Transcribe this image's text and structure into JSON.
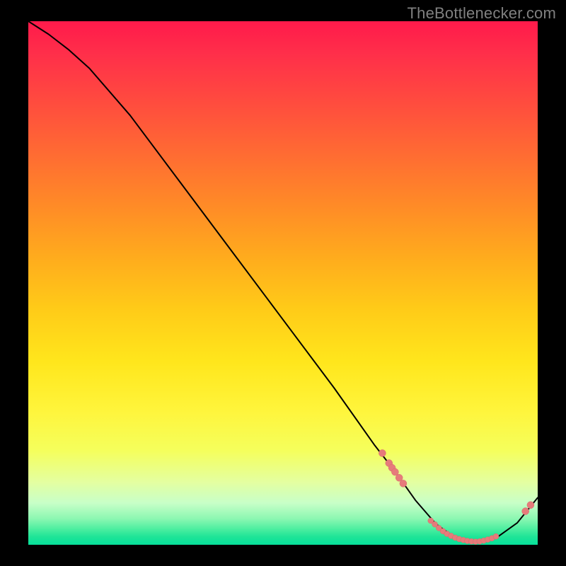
{
  "watermark": "TheBottlenecker.com",
  "colors": {
    "line": "#000000",
    "point_fill": "#e67b7b",
    "point_stroke": "#d86a6a",
    "gradient_top": "#ff1a4b",
    "gradient_bottom": "#07e09a",
    "background": "#000000"
  },
  "chart_data": {
    "type": "line",
    "title": "",
    "xlabel": "",
    "ylabel": "",
    "xlim": [
      0,
      100
    ],
    "ylim": [
      0,
      100
    ],
    "grid": false,
    "legend": false,
    "note": "Axes not labeled in source; x normalized 0–100 left→right, y 0–100 bottom→top. Curve is bottleneck-percentage shape: high at left, descends to ~0 near x≈85, then rises slightly.",
    "series": [
      {
        "name": "curve",
        "x": [
          0,
          4,
          8,
          12,
          20,
          30,
          40,
          50,
          60,
          68,
          72,
          76,
          80,
          84,
          88,
          92,
          96,
          100
        ],
        "y": [
          100,
          97.5,
          94.5,
          91,
          82,
          69,
          56,
          43,
          30,
          19,
          14,
          8.5,
          4,
          1.2,
          0.6,
          1.4,
          4.2,
          9
        ]
      }
    ],
    "points": [
      {
        "x": 69.5,
        "y": 17.5,
        "r": 5
      },
      {
        "x": 70.8,
        "y": 15.6,
        "r": 5
      },
      {
        "x": 71.4,
        "y": 14.7,
        "r": 5
      },
      {
        "x": 72.0,
        "y": 13.9,
        "r": 5
      },
      {
        "x": 72.8,
        "y": 12.8,
        "r": 5
      },
      {
        "x": 73.6,
        "y": 11.7,
        "r": 5
      },
      {
        "x": 79.0,
        "y": 4.6,
        "r": 4
      },
      {
        "x": 79.8,
        "y": 3.9,
        "r": 4
      },
      {
        "x": 80.6,
        "y": 3.2,
        "r": 4
      },
      {
        "x": 81.4,
        "y": 2.6,
        "r": 4
      },
      {
        "x": 82.2,
        "y": 2.1,
        "r": 4
      },
      {
        "x": 83.0,
        "y": 1.7,
        "r": 4
      },
      {
        "x": 83.8,
        "y": 1.35,
        "r": 4
      },
      {
        "x": 84.6,
        "y": 1.1,
        "r": 4
      },
      {
        "x": 85.4,
        "y": 0.9,
        "r": 4
      },
      {
        "x": 86.2,
        "y": 0.75,
        "r": 4
      },
      {
        "x": 87.0,
        "y": 0.65,
        "r": 4
      },
      {
        "x": 87.8,
        "y": 0.6,
        "r": 4
      },
      {
        "x": 88.6,
        "y": 0.65,
        "r": 4
      },
      {
        "x": 89.4,
        "y": 0.8,
        "r": 4
      },
      {
        "x": 90.2,
        "y": 1.0,
        "r": 4
      },
      {
        "x": 91.0,
        "y": 1.25,
        "r": 4
      },
      {
        "x": 91.8,
        "y": 1.6,
        "r": 4
      },
      {
        "x": 97.6,
        "y": 6.4,
        "r": 5
      },
      {
        "x": 98.6,
        "y": 7.6,
        "r": 5
      }
    ]
  }
}
